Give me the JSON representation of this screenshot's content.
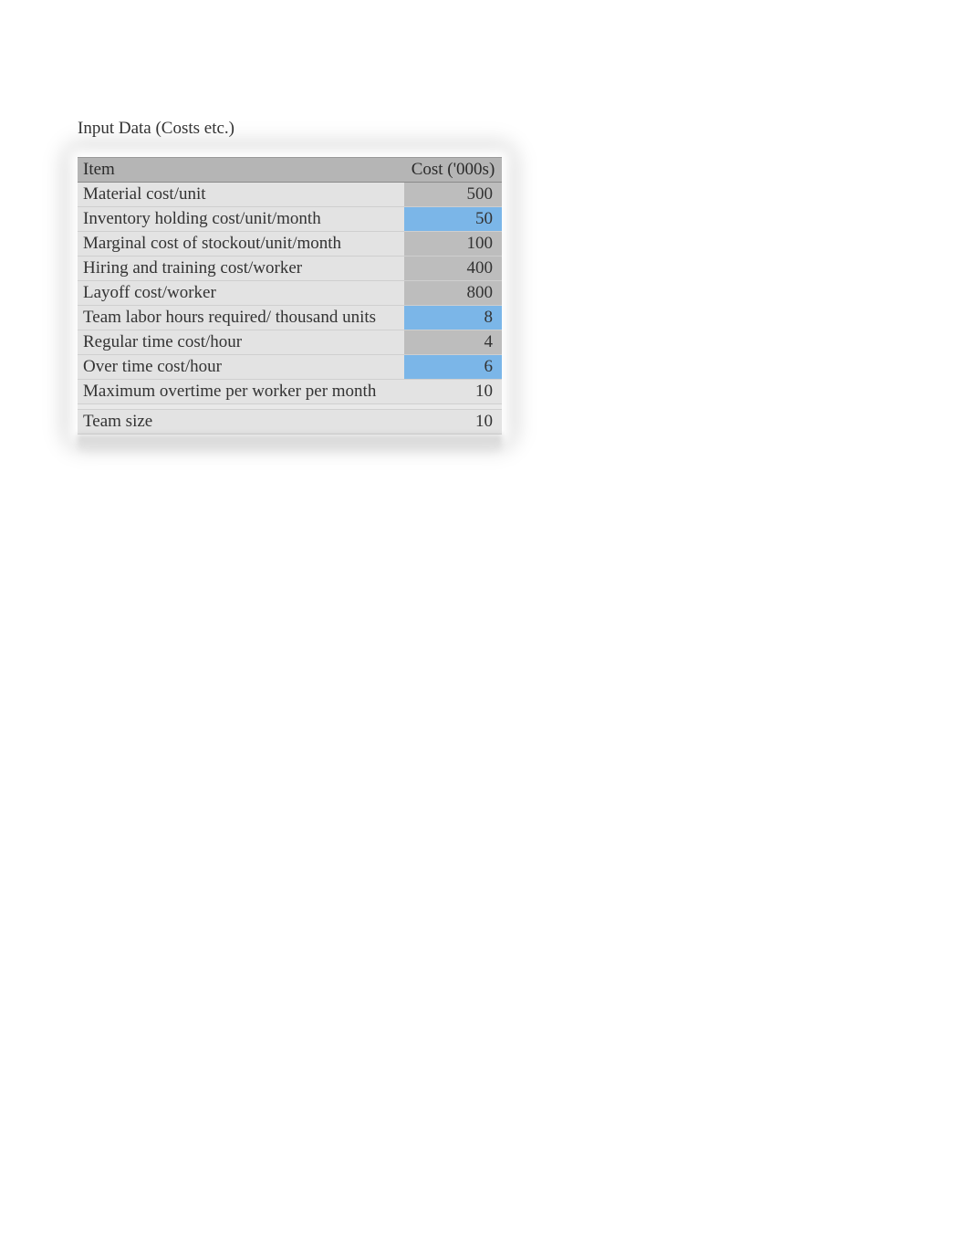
{
  "title": "Input Data (Costs etc.)",
  "headers": {
    "item": "Item",
    "cost": "Cost ('000s)"
  },
  "rows": [
    {
      "item": "Material cost/unit",
      "cost": "500",
      "costBg": "bg-gray"
    },
    {
      "item": "Inventory holding cost/unit/month",
      "cost": "50",
      "costBg": "bg-blue"
    },
    {
      "item": "Marginal cost of stockout/unit/month",
      "cost": "100",
      "costBg": "bg-gray"
    },
    {
      "item": "Hiring and training cost/worker",
      "cost": "400",
      "costBg": "bg-gray"
    },
    {
      "item": "Layoff cost/worker",
      "cost": "800",
      "costBg": "bg-gray"
    },
    {
      "item": "Team labor hours required/ thousand units",
      "cost": "8",
      "costBg": "bg-blue"
    },
    {
      "item": "Regular time cost/hour",
      "cost": "4",
      "costBg": "bg-gray"
    },
    {
      "item": "Over time cost/hour",
      "cost": "6",
      "costBg": "bg-blue"
    },
    {
      "item": "Maximum overtime per worker per month",
      "cost": "10",
      "costBg": "bg-light"
    },
    {
      "item": "Team size",
      "cost": "10",
      "costBg": "bg-light"
    }
  ],
  "chart_data": {
    "type": "table",
    "title": "Input Data (Costs etc.)",
    "columns": [
      "Item",
      "Cost ('000s)"
    ],
    "rows": [
      [
        "Material cost/unit",
        500
      ],
      [
        "Inventory holding cost/unit/month",
        50
      ],
      [
        "Marginal cost of stockout/unit/month",
        100
      ],
      [
        "Hiring and training cost/worker",
        400
      ],
      [
        "Layoff cost/worker",
        800
      ],
      [
        "Team labor hours required/ thousand units",
        8
      ],
      [
        "Regular time cost/hour",
        4
      ],
      [
        "Over time cost/hour",
        6
      ],
      [
        "Maximum overtime per worker per month",
        10
      ],
      [
        "Team size",
        10
      ]
    ]
  }
}
